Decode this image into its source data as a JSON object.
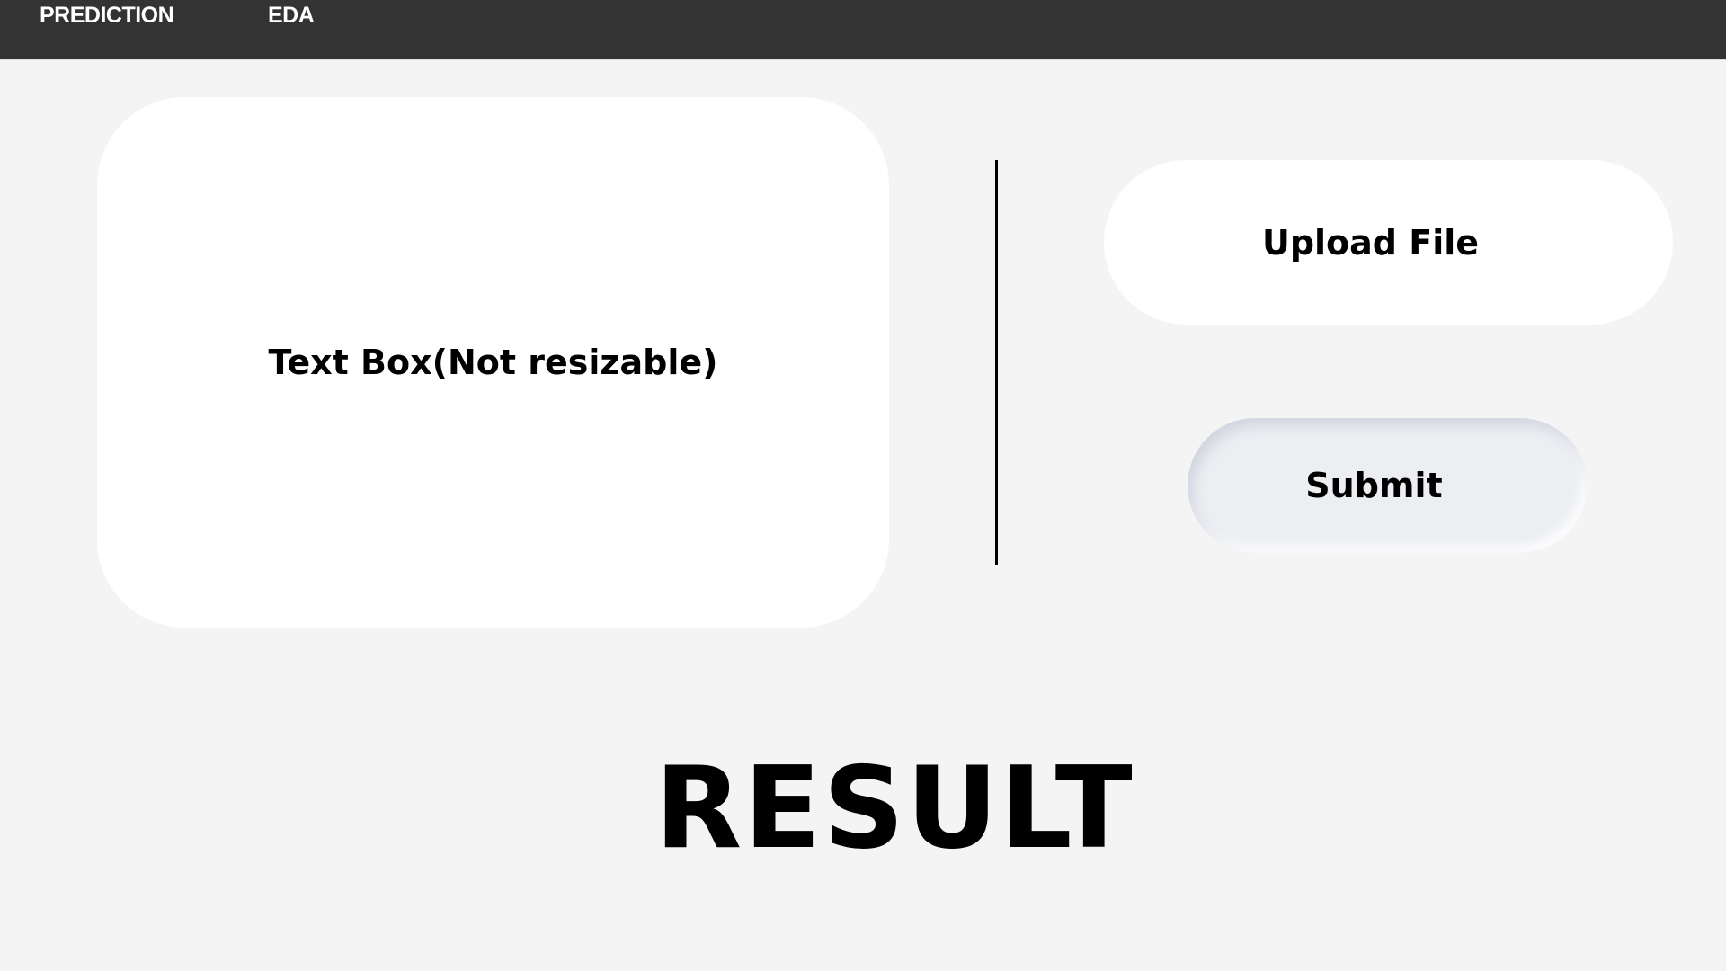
{
  "nav": {
    "items": [
      {
        "label": "PREDICTION"
      },
      {
        "label": "EDA"
      }
    ]
  },
  "main": {
    "text_box_label": "Text Box(Not resizable)",
    "upload_label": "Upload File",
    "submit_label": "Submit",
    "result_label": "RESULT"
  },
  "colors": {
    "nav_bg": "#333333",
    "page_bg": "#f4f4f4",
    "submit_bg": "#eceef2"
  }
}
